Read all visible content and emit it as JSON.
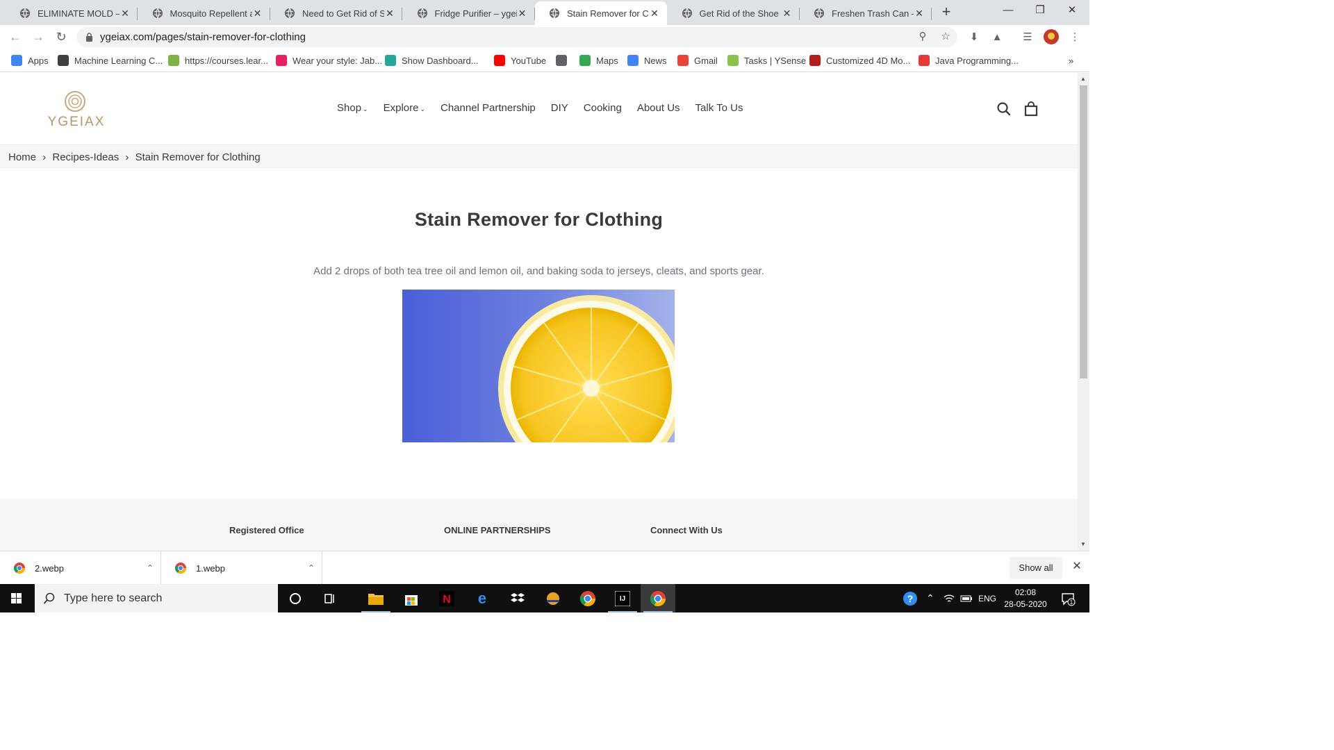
{
  "browser": {
    "tabs": [
      {
        "title": "ELIMINATE MOLD – yg",
        "active": false
      },
      {
        "title": "Mosquito Repellent at",
        "active": false
      },
      {
        "title": "Need to Get Rid of Sho",
        "active": false
      },
      {
        "title": "Fridge Purifier – ygeiax",
        "active": false
      },
      {
        "title": "Stain Remover for Clot",
        "active": true
      },
      {
        "title": "Get Rid of the Shoe Sm",
        "active": false
      },
      {
        "title": "Freshen Trash Can – yg",
        "active": false
      }
    ],
    "url": "ygeiax.com/pages/stain-remover-for-clothing",
    "bookmarks": [
      {
        "label": "Apps",
        "icon": "apps-grid-icon"
      },
      {
        "label": "Machine Learning C...",
        "icon": "ml-course-icon"
      },
      {
        "label": "https://courses.lear...",
        "icon": "courses-icon"
      },
      {
        "label": "Wear your style: Jab...",
        "icon": "myntra-icon"
      },
      {
        "label": "Show Dashboard...",
        "icon": "dashboard-icon"
      },
      {
        "label": "YouTube",
        "icon": "youtube-icon"
      },
      {
        "label": "",
        "icon": "globe-icon"
      },
      {
        "label": "Maps",
        "icon": "maps-icon"
      },
      {
        "label": "News",
        "icon": "news-icon"
      },
      {
        "label": "Gmail",
        "icon": "gmail-icon"
      },
      {
        "label": "Tasks | YSense",
        "icon": "ysense-icon"
      },
      {
        "label": "Customized 4D Mo...",
        "icon": "4d-icon"
      },
      {
        "label": "Java Programming...",
        "icon": "java-icon"
      }
    ],
    "bookmarks_overflow": "»"
  },
  "site": {
    "logo_text": "YGEIAX",
    "nav": [
      {
        "label": "Shop",
        "dropdown": true
      },
      {
        "label": "Explore",
        "dropdown": true
      },
      {
        "label": "Channel Partnership",
        "dropdown": false
      },
      {
        "label": "DIY",
        "dropdown": false
      },
      {
        "label": "Cooking",
        "dropdown": false
      },
      {
        "label": "About Us",
        "dropdown": false
      },
      {
        "label": "Talk To Us",
        "dropdown": false
      }
    ],
    "breadcrumb": [
      "Home",
      "Recipes-Ideas",
      "Stain Remover for Clothing"
    ],
    "breadcrumb_sep": "›",
    "title": "Stain Remover for Clothing",
    "description": "Add 2 drops of both tea tree oil and lemon oil, and baking soda to jerseys, cleats, and sports gear.",
    "footer_columns": [
      "Registered Office",
      "ONLINE PARTNERSHIPS",
      "Connect With Us"
    ]
  },
  "downloads": {
    "items": [
      "2.webp",
      "1.webp"
    ],
    "show_all": "Show all"
  },
  "taskbar": {
    "search_placeholder": "Type here to search",
    "language": "ENG",
    "time": "02:08",
    "date": "28-05-2020",
    "notification_count": "1"
  },
  "colors": {
    "brand_gold": "#b8956a",
    "text": "#3a3a3a",
    "muted": "#69727b"
  }
}
